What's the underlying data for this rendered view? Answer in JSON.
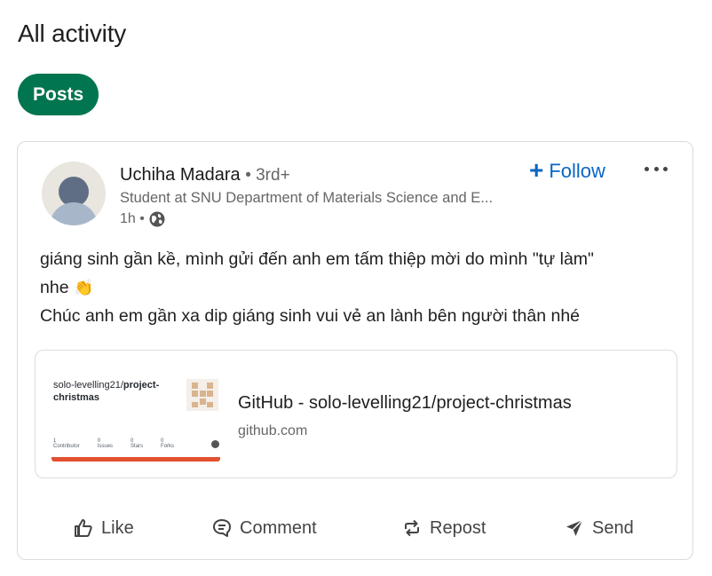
{
  "page": {
    "title": "All activity"
  },
  "filter": {
    "posts_label": "Posts"
  },
  "post": {
    "author": {
      "name": "Uchiha Madara",
      "degree": "• 3rd+",
      "headline": "Student at SNU Department of Materials Science and E...",
      "time": "1h •",
      "visibility_icon": "globe-icon"
    },
    "follow_label": "Follow",
    "text_line1": "giáng sinh gần kề, mình gửi đến anh em tấm thiệp mời do mình \"tự làm\"",
    "text_line2": "nhe",
    "text_line2_emoji": "👏",
    "text_line3": "Chúc anh em gần xa dip giáng sinh vui vẻ an lành bên người thân nhé",
    "link": {
      "thumb_repo_owner": "solo-levelling21/",
      "thumb_repo_name": "project-christmas",
      "thumb_stats": [
        {
          "num": "1",
          "label": "Contributor"
        },
        {
          "num": "0",
          "label": "Issues"
        },
        {
          "num": "0",
          "label": "Stars"
        },
        {
          "num": "0",
          "label": "Forks"
        }
      ],
      "title": "GitHub - solo-levelling21/project-christmas",
      "domain": "github.com"
    },
    "actions": {
      "like": "Like",
      "comment": "Comment",
      "repost": "Repost",
      "send": "Send"
    }
  },
  "colors": {
    "accent_green": "#01754f",
    "link_blue": "#0a66c2",
    "thumb_bar": "#e35130"
  }
}
